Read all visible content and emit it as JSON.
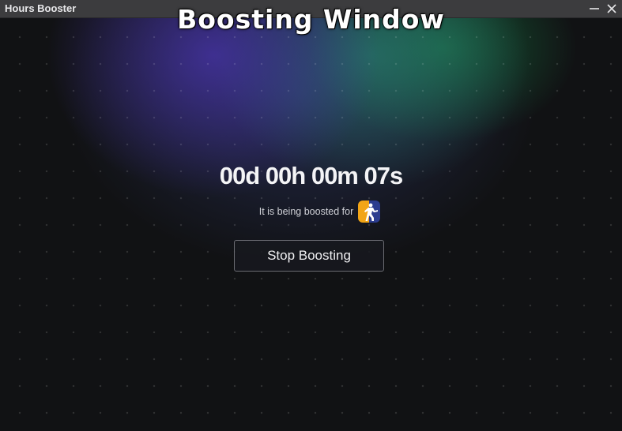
{
  "window": {
    "app_title": "Hours Booster",
    "overlay_title": "Boosting Window",
    "controls": {
      "minimize_icon": "minimize-icon",
      "close_icon": "close-icon"
    }
  },
  "main": {
    "timer": "00d 00h 00m 07s",
    "boost_label": "It is being boosted for",
    "game_icon": "game-icon",
    "stop_button_label": "Stop Boosting"
  },
  "colors": {
    "background": "#111214",
    "titlebar": "#3c3c3e",
    "glow_purple": "#4834aa",
    "glow_green": "#189650",
    "text": "#f4f4f6",
    "button_border": "#6a6b72"
  }
}
